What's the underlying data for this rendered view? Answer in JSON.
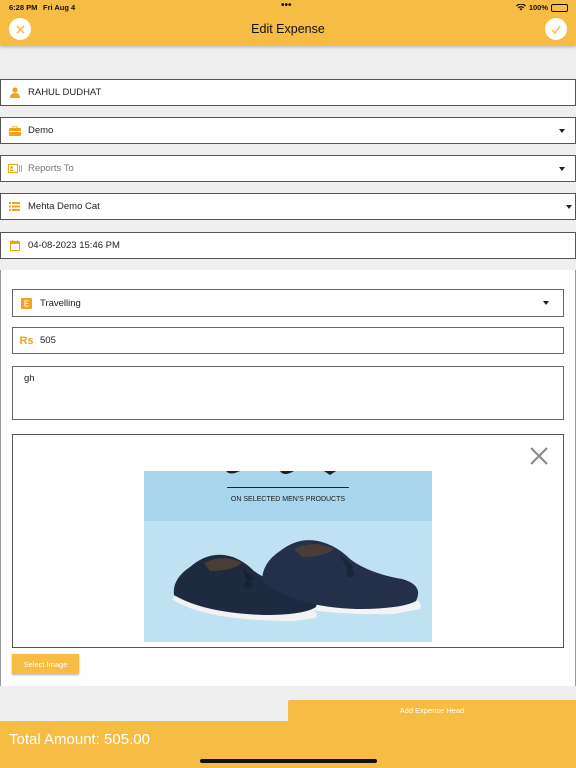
{
  "status": {
    "time": "6:28 PM",
    "date": "Fri Aug 4",
    "dots": "•••",
    "battery": "100%"
  },
  "header": {
    "title": "Edit Expense",
    "close_icon": "close-icon",
    "confirm_icon": "checkmark-icon"
  },
  "form": {
    "name": "RAHUL DUDHAT",
    "project": "Demo",
    "reports_to_placeholder": "Reports To",
    "category": "Mehta Demo Cat",
    "datetime": "04-08-2023 15:46 PM"
  },
  "expense": {
    "head": "Travelling",
    "currency_symbol": "Rs",
    "amount": "505",
    "note": "gh",
    "ad_text": "ON SELECTED MEN'S PRODUCTS",
    "select_image_label": "Select Image"
  },
  "actions": {
    "add_expense_head_label": "Add Expense Head"
  },
  "footer": {
    "total": "Total Amount: 505.00"
  },
  "colors": {
    "accent": "#f7bc44",
    "icon": "#f2a31b"
  }
}
